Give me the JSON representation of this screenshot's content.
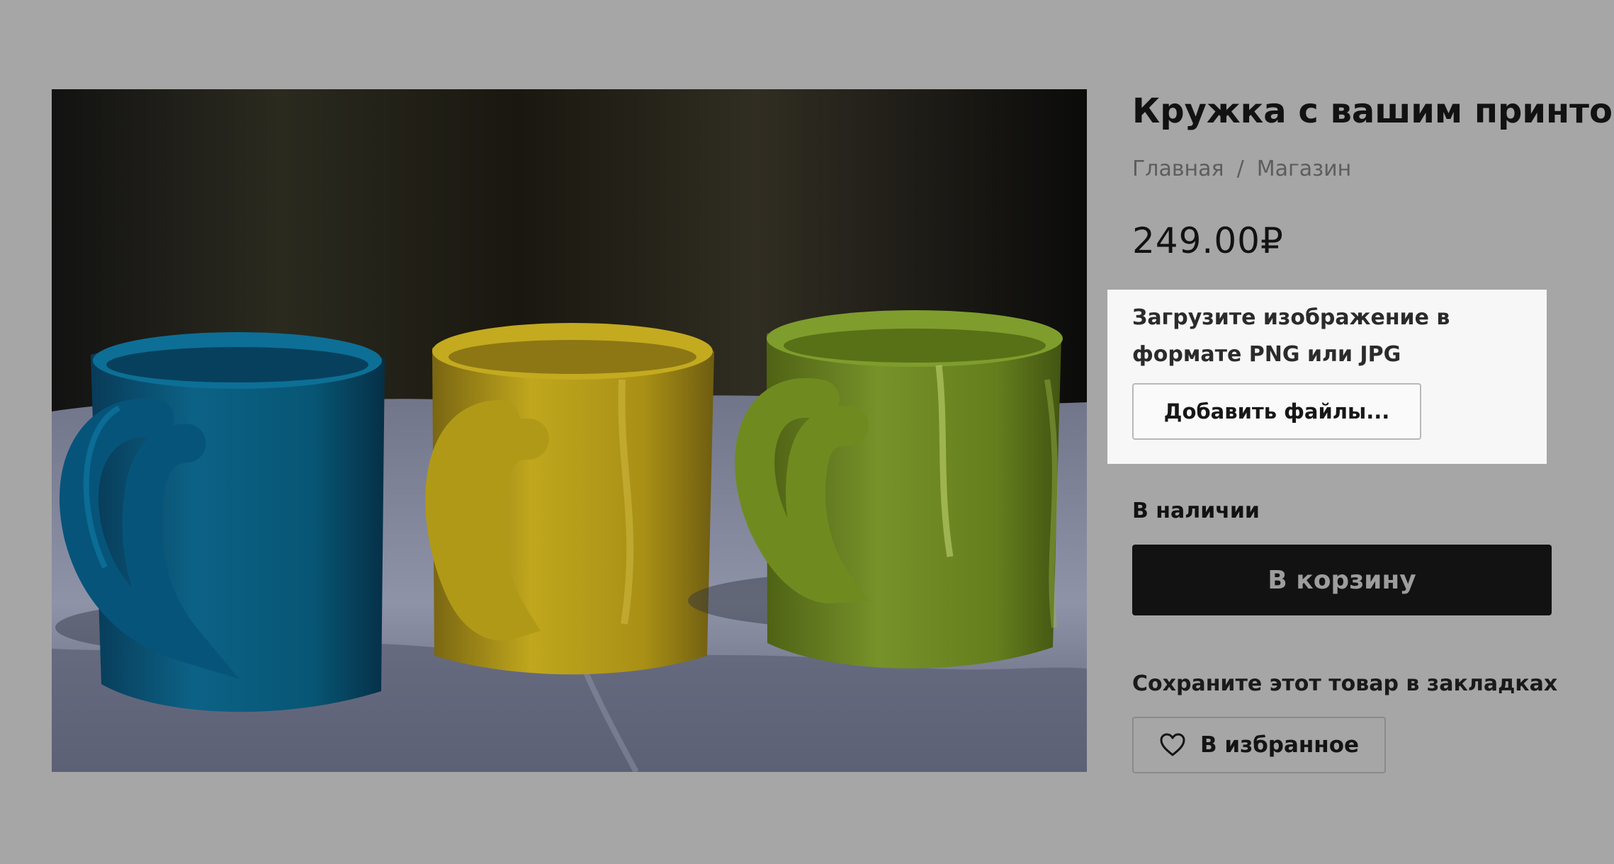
{
  "product": {
    "title": "Кружка с вашим принтом",
    "price": "249.00₽",
    "image_alt": "Three ceramic mugs"
  },
  "breadcrumb": {
    "items": [
      "Главная",
      "Магазин"
    ],
    "separator": "/"
  },
  "upload": {
    "text": "Загрузите изображение в формате PNG или JPG",
    "button_label": "Добавить файлы..."
  },
  "availability": {
    "text": "В наличии"
  },
  "cart": {
    "button_label": "В корзину"
  },
  "bookmark": {
    "label": "Сохраните этот товар в закладках",
    "button_label": "В избранное",
    "icon": "heart-icon"
  },
  "colors": {
    "overlay": "#a6a6a6",
    "upload_card": "#f7f7f7",
    "dark_button": "#121212",
    "blue_mug": "#075675",
    "yellow_mug": "#b59d19",
    "green_mug": "#6f8b1f"
  }
}
